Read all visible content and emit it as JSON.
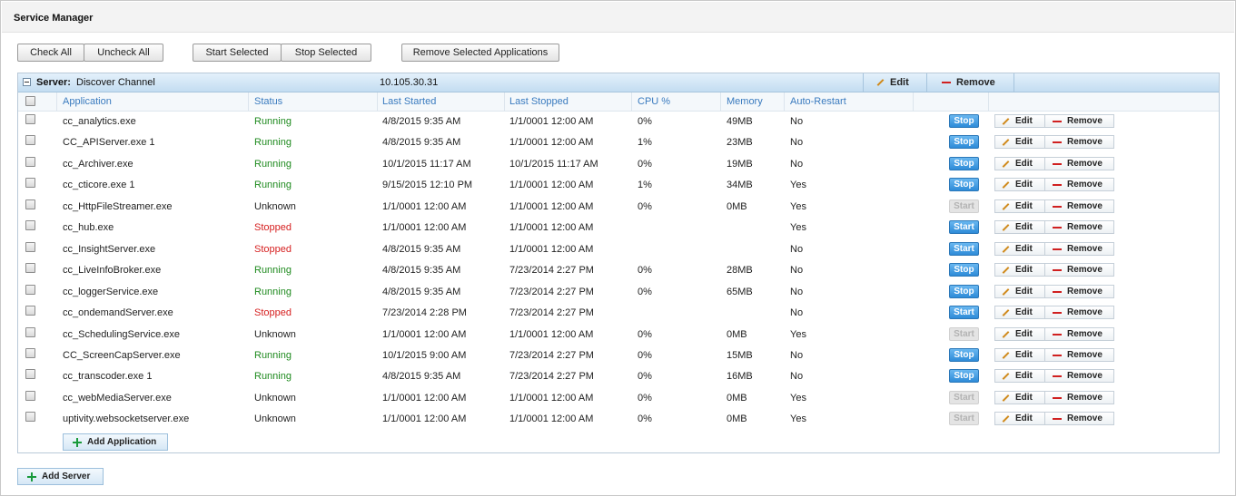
{
  "window": {
    "title": "Service Manager"
  },
  "toolbar": {
    "check_all": "Check All",
    "uncheck_all": "Uncheck All",
    "start_selected": "Start Selected",
    "stop_selected": "Stop Selected",
    "remove_selected": "Remove Selected Applications"
  },
  "server": {
    "label": "Server:",
    "name": "Discover Channel",
    "ip": "10.105.30.31",
    "edit_label": "Edit",
    "remove_label": "Remove"
  },
  "columns": [
    "Application",
    "Status",
    "Last Started",
    "Last Stopped",
    "CPU %",
    "Memory",
    "Auto-Restart"
  ],
  "rows": [
    {
      "app": "cc_analytics.exe",
      "status": "Running",
      "last_started": "4/8/2015 9:35 AM",
      "last_stopped": "1/1/0001 12:00 AM",
      "cpu": "0%",
      "memory": "49MB",
      "auto_restart": "No",
      "control": "Stop",
      "control_enabled": true
    },
    {
      "app": "CC_APIServer.exe 1",
      "status": "Running",
      "last_started": "4/8/2015 9:35 AM",
      "last_stopped": "1/1/0001 12:00 AM",
      "cpu": "1%",
      "memory": "23MB",
      "auto_restart": "No",
      "control": "Stop",
      "control_enabled": true
    },
    {
      "app": "cc_Archiver.exe",
      "status": "Running",
      "last_started": "10/1/2015 11:17 AM",
      "last_stopped": "10/1/2015 11:17 AM",
      "cpu": "0%",
      "memory": "19MB",
      "auto_restart": "No",
      "control": "Stop",
      "control_enabled": true
    },
    {
      "app": "cc_cticore.exe 1",
      "status": "Running",
      "last_started": "9/15/2015 12:10 PM",
      "last_stopped": "1/1/0001 12:00 AM",
      "cpu": "1%",
      "memory": "34MB",
      "auto_restart": "Yes",
      "control": "Stop",
      "control_enabled": true
    },
    {
      "app": "cc_HttpFileStreamer.exe",
      "status": "Unknown",
      "last_started": "1/1/0001 12:00 AM",
      "last_stopped": "1/1/0001 12:00 AM",
      "cpu": "0%",
      "memory": "0MB",
      "auto_restart": "Yes",
      "control": "Start",
      "control_enabled": false
    },
    {
      "app": "cc_hub.exe",
      "status": "Stopped",
      "last_started": "1/1/0001 12:00 AM",
      "last_stopped": "1/1/0001 12:00 AM",
      "cpu": "",
      "memory": "",
      "auto_restart": "Yes",
      "control": "Start",
      "control_enabled": true
    },
    {
      "app": "cc_InsightServer.exe",
      "status": "Stopped",
      "last_started": "4/8/2015 9:35 AM",
      "last_stopped": "1/1/0001 12:00 AM",
      "cpu": "",
      "memory": "",
      "auto_restart": "No",
      "control": "Start",
      "control_enabled": true
    },
    {
      "app": "cc_LiveInfoBroker.exe",
      "status": "Running",
      "last_started": "4/8/2015 9:35 AM",
      "last_stopped": "7/23/2014 2:27 PM",
      "cpu": "0%",
      "memory": "28MB",
      "auto_restart": "No",
      "control": "Stop",
      "control_enabled": true
    },
    {
      "app": "cc_loggerService.exe",
      "status": "Running",
      "last_started": "4/8/2015 9:35 AM",
      "last_stopped": "7/23/2014 2:27 PM",
      "cpu": "0%",
      "memory": "65MB",
      "auto_restart": "No",
      "control": "Stop",
      "control_enabled": true
    },
    {
      "app": "cc_ondemandServer.exe",
      "status": "Stopped",
      "last_started": "7/23/2014 2:28 PM",
      "last_stopped": "7/23/2014 2:27 PM",
      "cpu": "",
      "memory": "",
      "auto_restart": "No",
      "control": "Start",
      "control_enabled": true
    },
    {
      "app": "cc_SchedulingService.exe",
      "status": "Unknown",
      "last_started": "1/1/0001 12:00 AM",
      "last_stopped": "1/1/0001 12:00 AM",
      "cpu": "0%",
      "memory": "0MB",
      "auto_restart": "Yes",
      "control": "Start",
      "control_enabled": false
    },
    {
      "app": "CC_ScreenCapServer.exe",
      "status": "Running",
      "last_started": "10/1/2015 9:00 AM",
      "last_stopped": "7/23/2014 2:27 PM",
      "cpu": "0%",
      "memory": "15MB",
      "auto_restart": "No",
      "control": "Stop",
      "control_enabled": true
    },
    {
      "app": "cc_transcoder.exe 1",
      "status": "Running",
      "last_started": "4/8/2015 9:35 AM",
      "last_stopped": "7/23/2014 2:27 PM",
      "cpu": "0%",
      "memory": "16MB",
      "auto_restart": "No",
      "control": "Stop",
      "control_enabled": true
    },
    {
      "app": "cc_webMediaServer.exe",
      "status": "Unknown",
      "last_started": "1/1/0001 12:00 AM",
      "last_stopped": "1/1/0001 12:00 AM",
      "cpu": "0%",
      "memory": "0MB",
      "auto_restart": "Yes",
      "control": "Start",
      "control_enabled": false
    },
    {
      "app": "uptivity.websocketserver.exe",
      "status": "Unknown",
      "last_started": "1/1/0001 12:00 AM",
      "last_stopped": "1/1/0001 12:00 AM",
      "cpu": "0%",
      "memory": "0MB",
      "auto_restart": "Yes",
      "control": "Start",
      "control_enabled": false
    }
  ],
  "row_actions": {
    "edit": "Edit",
    "remove": "Remove"
  },
  "add_application": "Add Application",
  "add_server": "Add Server",
  "colors": {
    "running": "#1e8a1e",
    "stopped": "#d62020",
    "header_text": "#3a7bbf",
    "button_blue": "#2e8bd8"
  }
}
